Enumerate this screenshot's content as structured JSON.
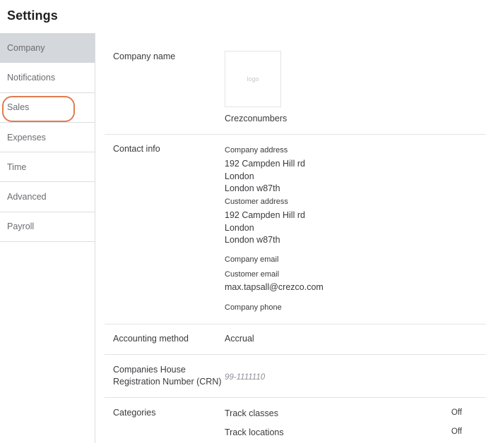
{
  "page_title": "Settings",
  "sidebar": {
    "items": [
      {
        "label": "Company"
      },
      {
        "label": "Notifications"
      },
      {
        "label": "Sales"
      },
      {
        "label": "Expenses"
      },
      {
        "label": "Time"
      },
      {
        "label": "Advanced"
      },
      {
        "label": "Payroll"
      }
    ],
    "active_index": 0,
    "highlighted_index": 2
  },
  "company_name": {
    "label": "Company name",
    "logo_placeholder": "logo",
    "value": "Crezconumbers"
  },
  "contact_info": {
    "label": "Contact info",
    "company_address_heading": "Company address",
    "company_address": [
      "192 Campden Hill rd",
      "London",
      "London w87th"
    ],
    "customer_address_heading": "Customer address",
    "customer_address": [
      "192 Campden Hill rd",
      "London",
      "London w87th"
    ],
    "company_email_heading": "Company email",
    "customer_email_heading": "Customer email",
    "customer_email": "max.tapsall@crezco.com",
    "company_phone_heading": "Company phone"
  },
  "accounting_method": {
    "label": "Accounting method",
    "value": "Accrual"
  },
  "crn": {
    "label_line1": "Companies House",
    "label_line2": "Registration Number (CRN)",
    "value": "99-1111110"
  },
  "categories": {
    "label": "Categories",
    "items": [
      {
        "label": "Track classes",
        "state": "Off"
      },
      {
        "label": "Track locations",
        "state": "Off"
      }
    ]
  },
  "colors": {
    "highlight_ring": "#e07c4f",
    "active_nav_bg": "#d4d7dc"
  }
}
